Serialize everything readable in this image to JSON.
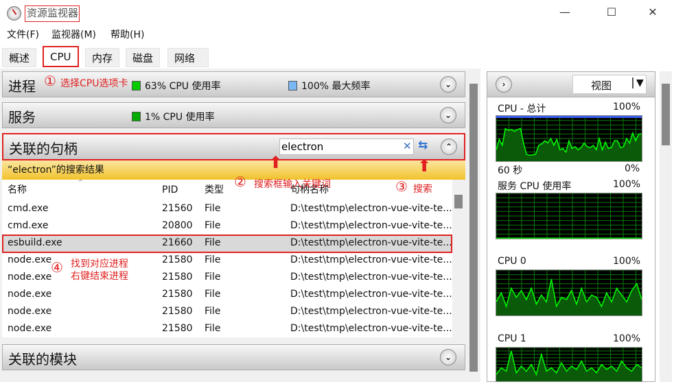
{
  "window": {
    "title": "资源监视器",
    "controls": [
      "—",
      "☐",
      "✕"
    ]
  },
  "menu": [
    "文件(F)",
    "监视器(M)",
    "帮助(H)"
  ],
  "tabs": [
    "概述",
    "CPU",
    "内存",
    "磁盘",
    "网络"
  ],
  "sections": {
    "processes": {
      "title": "进程",
      "cpu_usage": "63% CPU 使用率",
      "max_freq": "100% 最大频率"
    },
    "services": {
      "title": "服务",
      "cpu_usage": "1% CPU 使用率"
    },
    "handles": {
      "title": "关联的句柄",
      "search_value": "electron",
      "results_label": "“electron”的搜索结果",
      "columns": [
        "名称",
        "PID",
        "类型",
        "句柄名称"
      ],
      "rows": [
        [
          "cmd.exe",
          "21560",
          "File",
          "D:\\test\\tmp\\electron-vue-vite-te..."
        ],
        [
          "cmd.exe",
          "20800",
          "File",
          "D:\\test\\tmp\\electron-vue-vite-te..."
        ],
        [
          "esbuild.exe",
          "21660",
          "File",
          "D:\\test\\tmp\\electron-vue-vite-te..."
        ],
        [
          "node.exe",
          "21580",
          "File",
          "D:\\test\\tmp\\electron-vue-vite-te..."
        ],
        [
          "node.exe",
          "21580",
          "File",
          "D:\\test\\tmp\\electron-vue-vite-te..."
        ],
        [
          "node.exe",
          "21580",
          "File",
          "D:\\test\\tmp\\electron-vue-vite-te..."
        ],
        [
          "node.exe",
          "21580",
          "File",
          "D:\\test\\tmp\\electron-vue-vite-te..."
        ],
        [
          "node.exe",
          "21580",
          "File",
          "D:\\test\\tmp\\electron-vue-vite-te..."
        ]
      ],
      "selected_row": 2
    },
    "modules": {
      "title": "关联的模块"
    }
  },
  "right_panel": {
    "view_label": "视图",
    "graphs": [
      {
        "title": "CPU - 总计",
        "max": "100%",
        "min": "0%",
        "time": "60 秒",
        "values": [
          25,
          48,
          35,
          72,
          68,
          70,
          66,
          70,
          72,
          40,
          15,
          13,
          14,
          15,
          35,
          38,
          45,
          40,
          50,
          35,
          48,
          25,
          28,
          20,
          45,
          28,
          32,
          25,
          30,
          40,
          32,
          30,
          35,
          25,
          50,
          25,
          42,
          28,
          30,
          45,
          45,
          30,
          32,
          50,
          40,
          62,
          45,
          60,
          60
        ]
      },
      {
        "title": "服务 CPU 使用率",
        "max": "100%",
        "values": [
          1,
          1,
          1,
          1,
          1,
          1,
          1,
          1,
          1,
          1,
          1,
          1,
          1,
          1,
          1,
          1,
          1,
          1,
          1,
          1,
          1,
          1,
          1,
          1,
          1
        ]
      },
      {
        "title": "CPU 0",
        "max": "100%",
        "values": [
          30,
          50,
          20,
          60,
          40,
          55,
          35,
          60,
          25,
          45,
          30,
          80,
          20,
          40,
          35,
          55,
          25,
          60,
          30,
          45,
          40,
          20,
          50,
          30,
          60,
          45,
          30,
          55,
          70,
          35
        ]
      },
      {
        "title": "CPU 1",
        "max": "100%",
        "values": [
          20,
          40,
          30,
          90,
          25,
          45,
          30,
          50,
          20,
          80,
          30,
          40,
          25,
          55,
          30,
          45,
          35,
          60,
          30,
          40,
          25,
          50,
          35,
          45,
          30,
          60,
          40,
          30,
          50,
          40
        ]
      }
    ]
  },
  "annotations": [
    "①",
    "选择CPU选项卡",
    "②",
    "搜索框输入关键词",
    "③",
    "搜索",
    "④",
    "找到对应进程",
    "右键结束进程"
  ],
  "colors": {
    "annotation": "#e02020",
    "graph_line": "#00ff00",
    "results_bar": "#f5c518"
  }
}
